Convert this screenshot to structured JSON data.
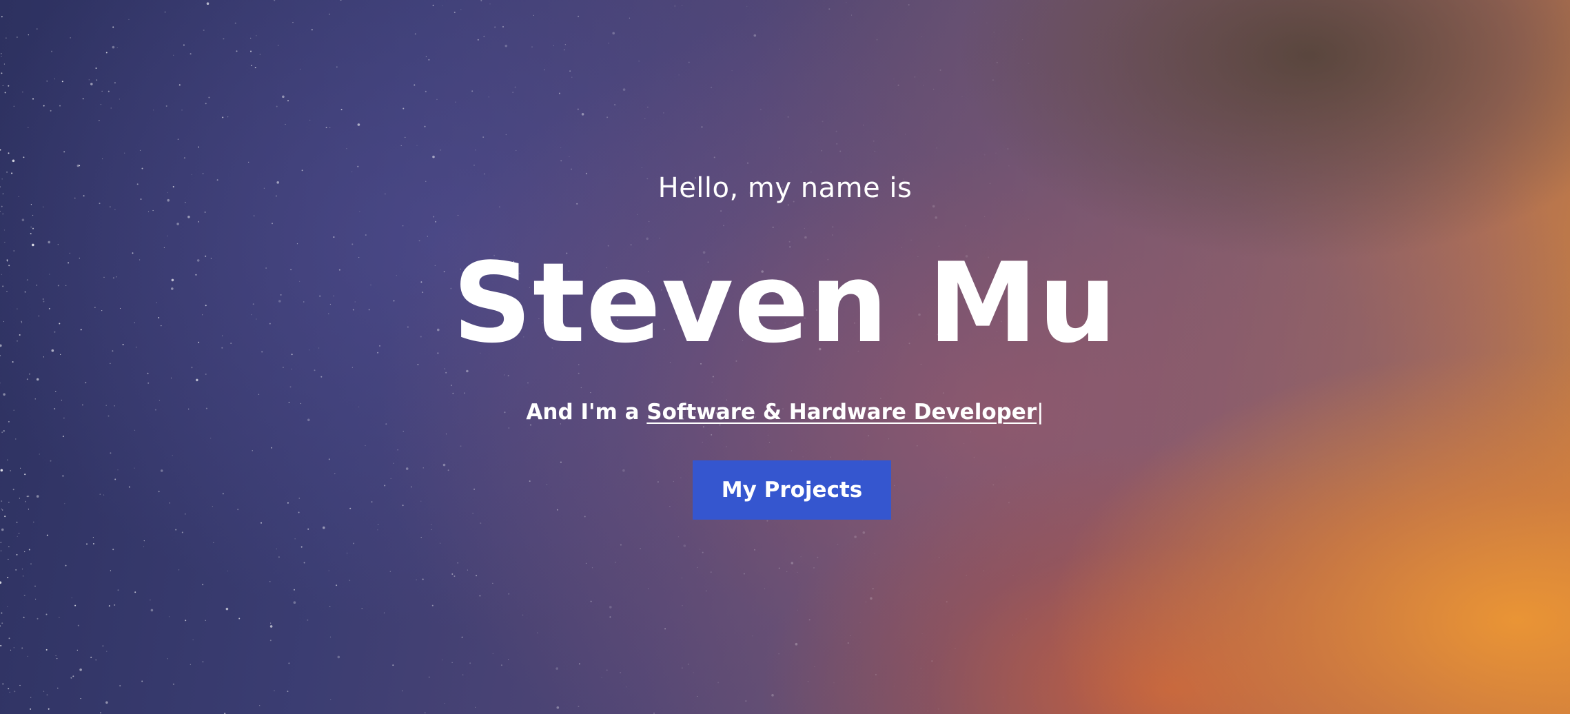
{
  "hero": {
    "greeting": "Hello, my name is",
    "name": "Steven Mu",
    "tagline_prefix": "And I'm a ",
    "tagline_role": "Software & Hardware Developer",
    "cursor": "|",
    "cta_label": "My Projects"
  },
  "colors": {
    "button_bg": "#3556cf",
    "text": "#ffffff",
    "bg_left": "#2d3160",
    "bg_right": "#e08a36"
  }
}
